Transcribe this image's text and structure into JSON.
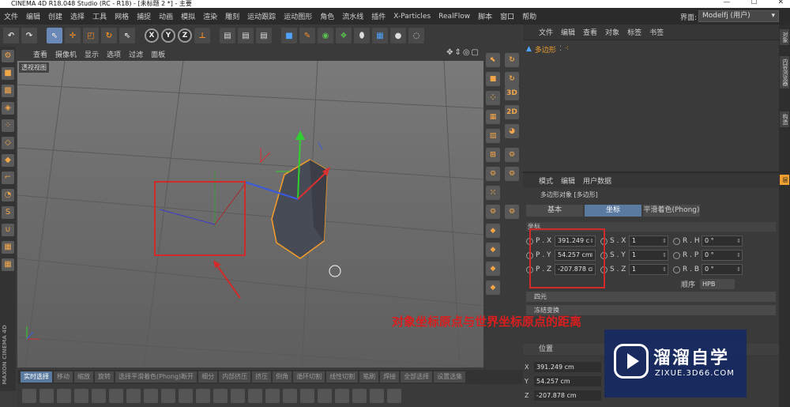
{
  "window": {
    "title": "CINEMA 4D R18.048 Studio (RC - R18) - [未标题 2 *] - 主要",
    "controls": [
      "—",
      "☐",
      "✕"
    ]
  },
  "menubar": {
    "items": [
      "文件",
      "编辑",
      "创建",
      "选择",
      "工具",
      "网格",
      "捕捉",
      "动画",
      "模拟",
      "渲染",
      "雕刻",
      "运动跟踪",
      "运动图形",
      "角色",
      "流水线",
      "插件",
      "X-Particles",
      "RealFlow",
      "脚本",
      "窗口",
      "帮助"
    ],
    "layout_label": "界面:",
    "layout_value": "Modelfj (用户)"
  },
  "toolbar": {
    "axis_x": "X",
    "axis_y": "Y",
    "axis_z": "Z"
  },
  "viewport": {
    "menu": [
      "查看",
      "摄像机",
      "显示",
      "选项",
      "过滤",
      "面板"
    ],
    "label": "透视视图",
    "nav_icons": "✥⇕◎▢"
  },
  "right_tools": {
    "label_3d": "3D",
    "label_2d": "2D"
  },
  "object_manager": {
    "menu": [
      "文件",
      "编辑",
      "查看",
      "对象",
      "标签",
      "书签"
    ],
    "object_name": "多边形"
  },
  "attribute_manager": {
    "menu": [
      "模式",
      "编辑",
      "用户数据"
    ],
    "title": "多边形对象 [多边形]",
    "tabs": [
      "基本",
      "坐标",
      "平滑着色(Phong)"
    ],
    "active_tab": "坐标",
    "section": "坐标",
    "rows": [
      {
        "p_label": "P . X",
        "p_value": "391.249 c",
        "s_label": "S . X",
        "s_value": "1",
        "r_label": "R . H",
        "r_value": "0 °"
      },
      {
        "p_label": "P . Y",
        "p_value": "54.257 cm",
        "s_label": "S . Y",
        "s_value": "1",
        "r_label": "R . P",
        "r_value": "0 °"
      },
      {
        "p_label": "P . Z",
        "p_value": "-207.878 c",
        "s_label": "S . Z",
        "s_value": "1",
        "r_label": "R . B",
        "r_value": "0 °"
      }
    ],
    "order_label": "顺序",
    "order_value": "HPB",
    "fold_1": "四元",
    "fold_2": "冻结变换"
  },
  "coordinates_panel": {
    "title": "位置",
    "x_label": "X",
    "x_value": "391.249 cm",
    "y_label": "Y",
    "y_value": "54.257 cm",
    "z_label": "Z",
    "z_value": "-207.878 cm"
  },
  "side_tabs": [
    "对象",
    "内容浏览器",
    "构造",
    "层"
  ],
  "bottom_bar": {
    "items": [
      "实时选择",
      "移动",
      "缩放",
      "旋转",
      "选择平滑着色(Phong)断开",
      "细分",
      "内部挤压",
      "挤压",
      "倒角",
      "循环切割",
      "线性切割",
      "笔刷",
      "焊接",
      "全部选择",
      "设置选集"
    ]
  },
  "brand_vertical": "MAXON CINEMA 4D",
  "annotation": {
    "text": "对象坐标原点与世界坐标原点的距离",
    "color": "#d81e1e"
  },
  "watermark": {
    "title": "溜溜自学",
    "subtitle": "ZIXUE.3D66.COM"
  }
}
